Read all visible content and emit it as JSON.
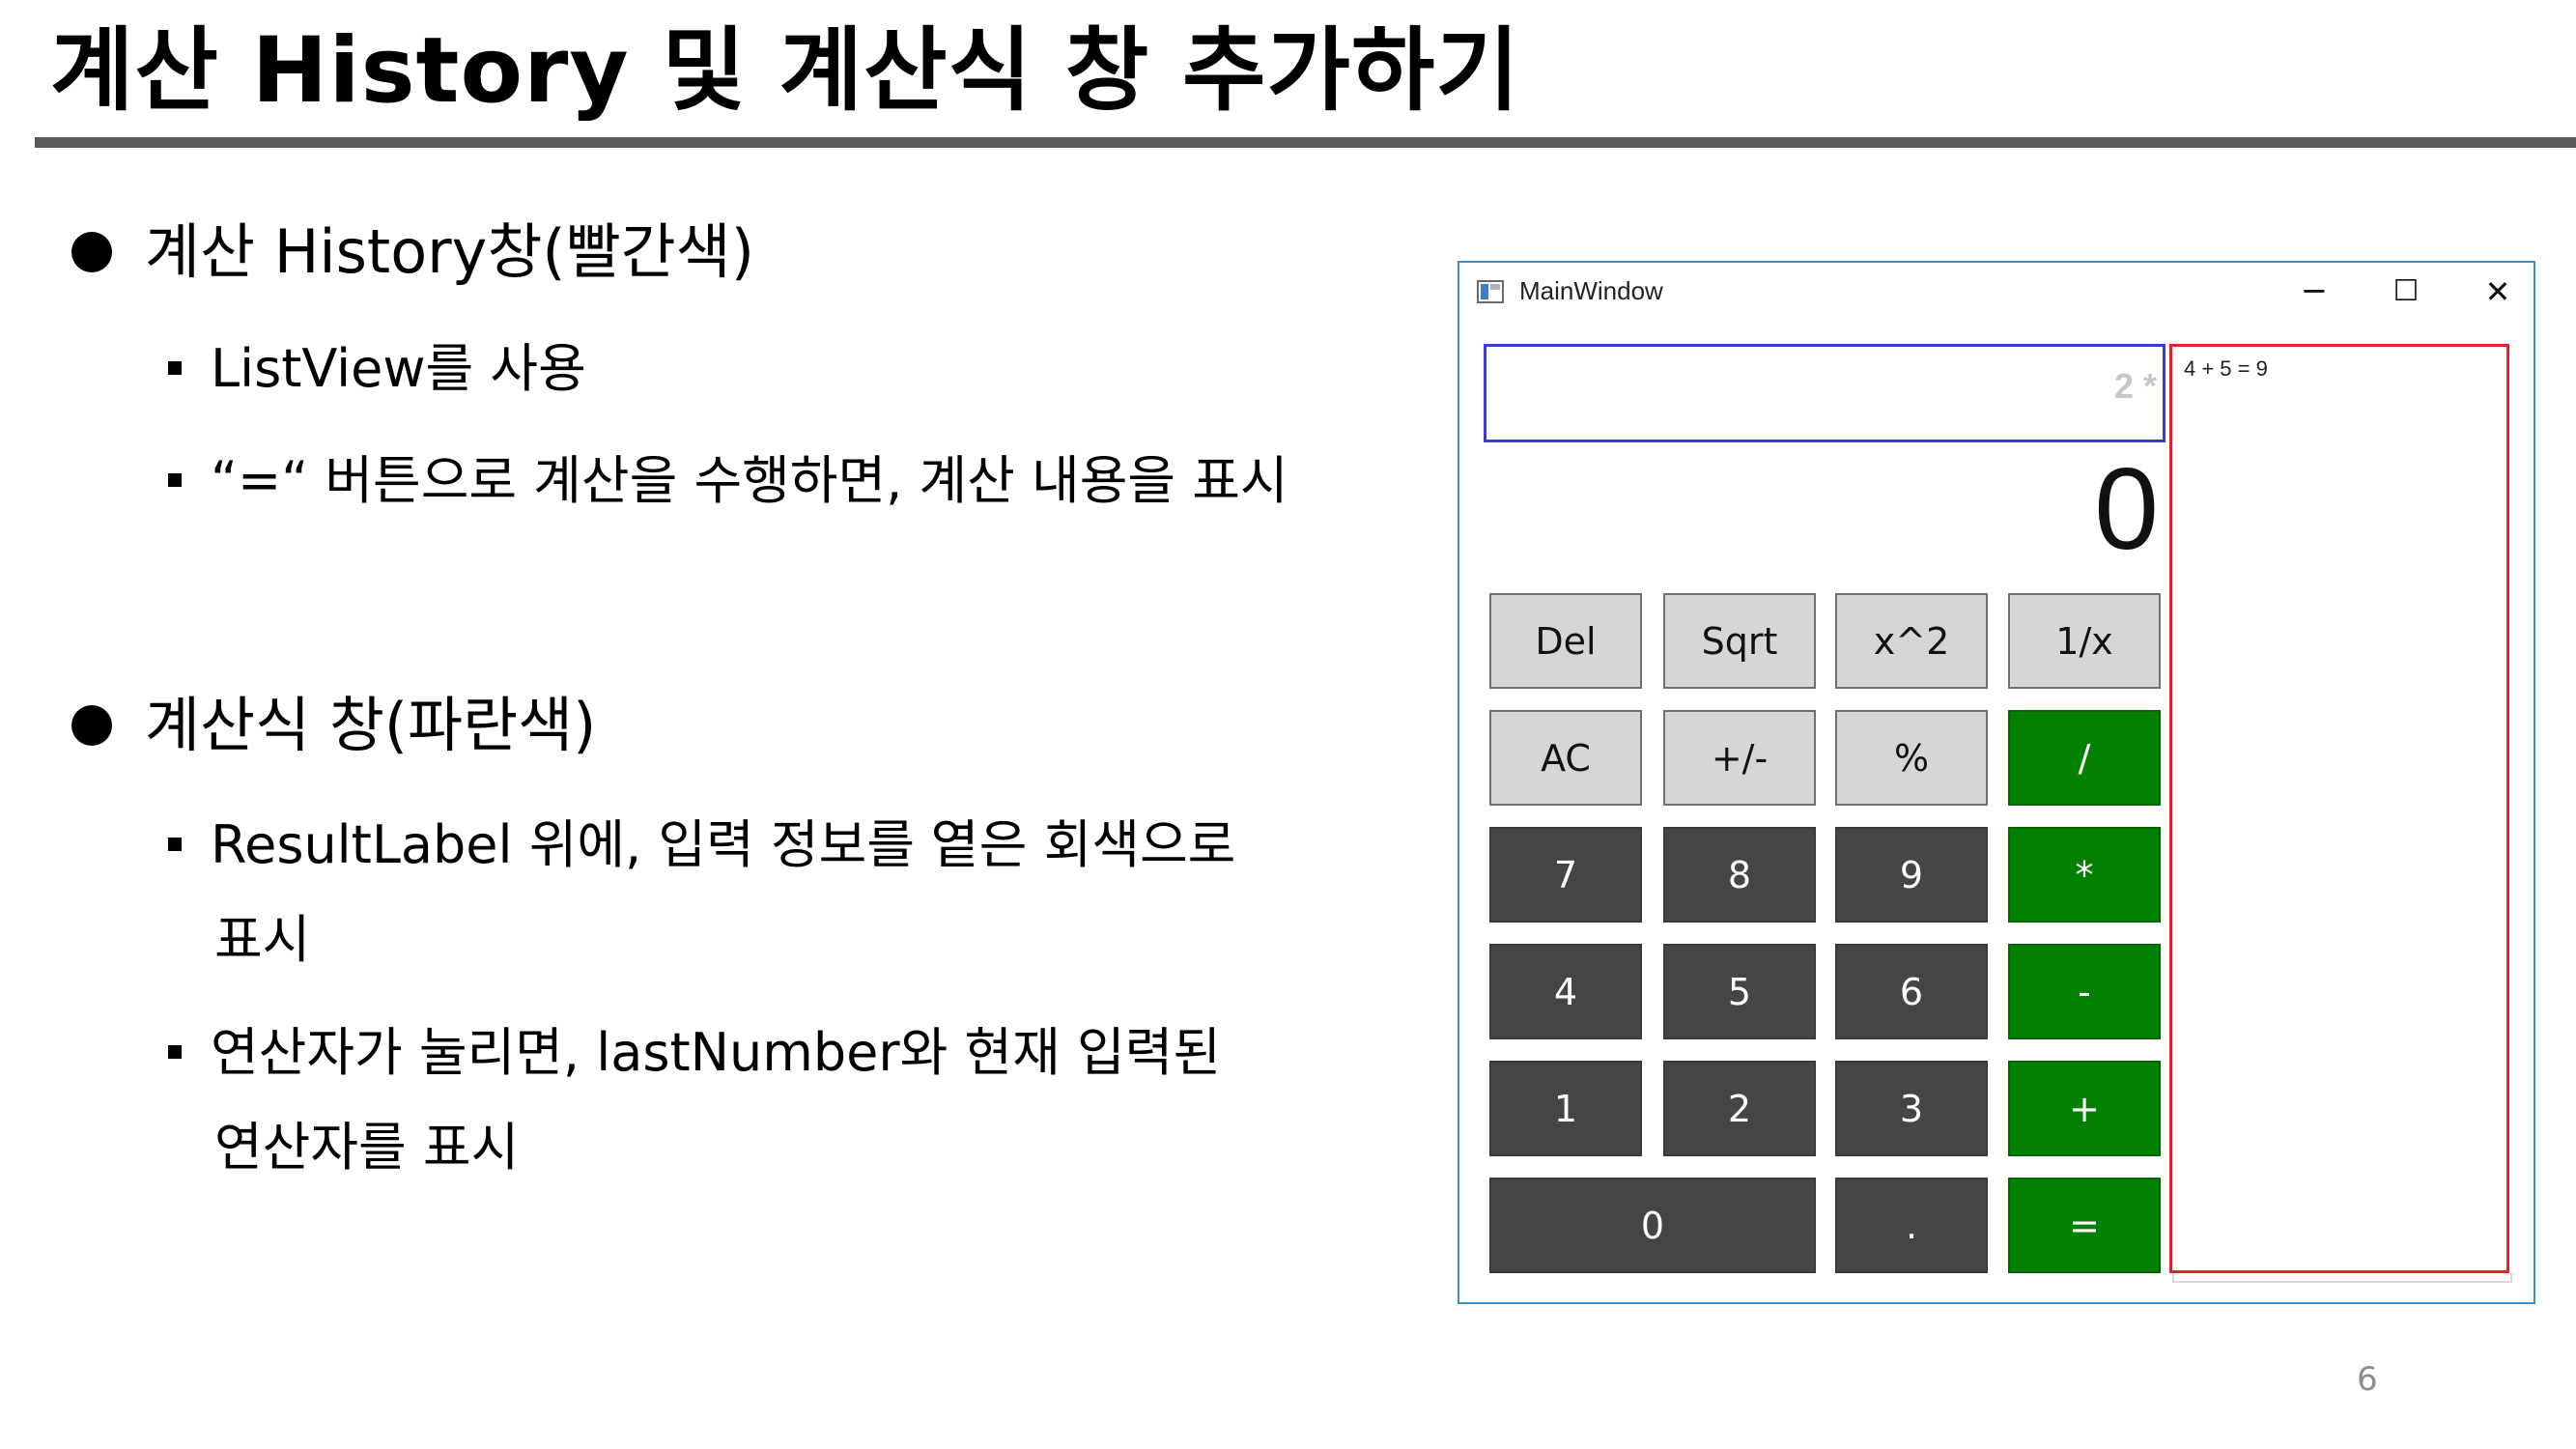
{
  "slide": {
    "title": "계산 History 및 계산식 창 추가하기",
    "page_number": "6"
  },
  "bullets": {
    "history_heading": "계산 History창(빨간색)",
    "history_sub1": "ListView를 사용",
    "history_sub2": "“=“ 버튼으로 계산을 수행하면, 계산 내용을 표시",
    "expr_heading": "계산식 창(파란색)",
    "expr_sub1_line1": "ResultLabel 위에, 입력 정보를 옅은 회색으로",
    "expr_sub1_line2": "표시",
    "expr_sub2_line1": "연산자가 눌리면, lastNumber와 현재 입력된",
    "expr_sub2_line2": "연산자를 표시"
  },
  "window": {
    "title": "MainWindow",
    "minimize": "─",
    "maximize": "☐",
    "close": "✕",
    "expression": "2 *",
    "result": "0",
    "history": [
      "4 + 5 = 9"
    ]
  },
  "buttons": {
    "del": "Del",
    "sqrt": "Sqrt",
    "square": "x^2",
    "reciprocal": "1/x",
    "ac": "AC",
    "negate": "+/-",
    "percent": "%",
    "divide": "/",
    "seven": "7",
    "eight": "8",
    "nine": "9",
    "multiply": "*",
    "four": "4",
    "five": "5",
    "six": "6",
    "minus": "-",
    "one": "1",
    "two": "2",
    "three": "3",
    "plus": "+",
    "zero": "0",
    "dot": ".",
    "equals": "="
  },
  "colors": {
    "expression_border": "#3a3ad8",
    "history_border": "#e8202a",
    "operator_green": "#028002",
    "digit_dark": "#454545",
    "function_light": "#d6d6d6"
  }
}
